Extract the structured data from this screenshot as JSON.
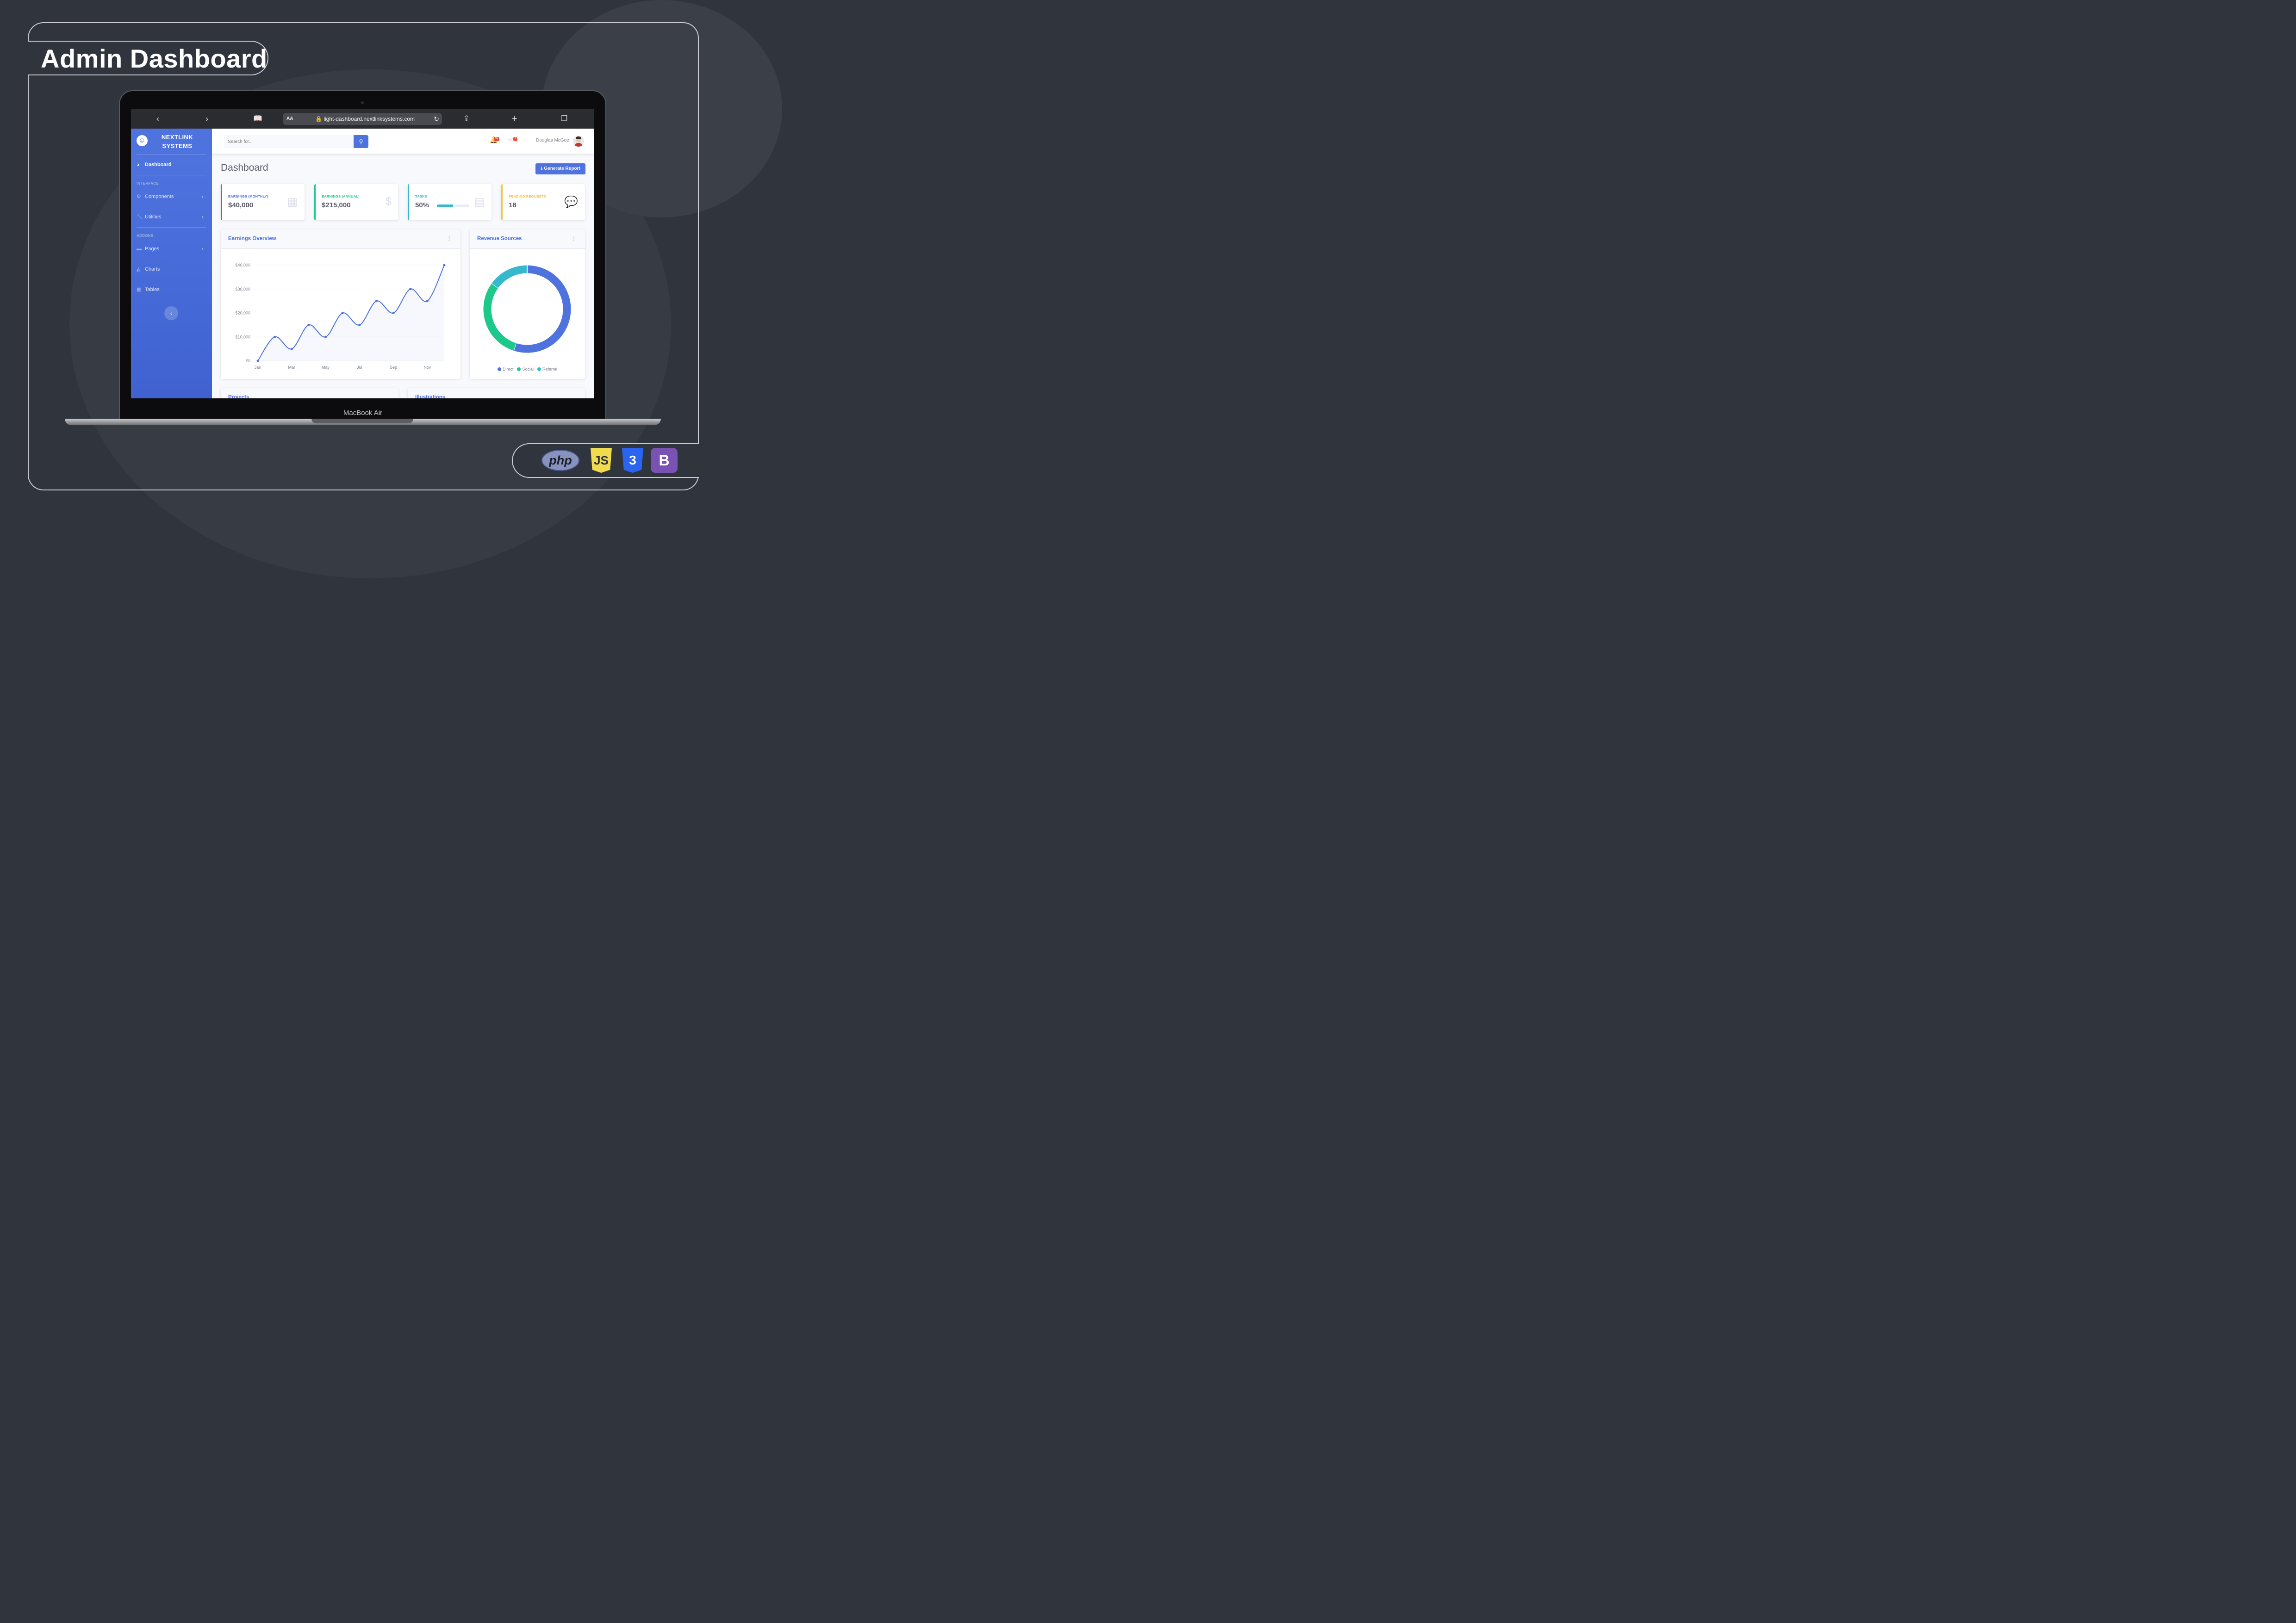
{
  "poster": {
    "title": "Admin Dashboard",
    "device_label": "MacBook Air",
    "tech_logos": [
      {
        "name": "php-logo",
        "text": "php",
        "color": "#8892bf"
      },
      {
        "name": "javascript-logo",
        "text": "JS",
        "color": "#f0db4f"
      },
      {
        "name": "css3-logo",
        "text": "3",
        "color": "#2965f1"
      },
      {
        "name": "bootstrap-logo",
        "text": "B",
        "color": "#7952b3"
      }
    ]
  },
  "browser": {
    "text_size_label": "AA",
    "url": "light-dashboard.nextlinksystems.com"
  },
  "sidebar": {
    "brand": "NEXTLINK SYSTEMS",
    "headings": [
      "INTERFACE",
      "ADDONS"
    ],
    "items": [
      {
        "label": "Dashboard",
        "icon": "tachometer-icon",
        "active": true
      },
      {
        "label": "Components",
        "icon": "cog-icon",
        "has_children": true
      },
      {
        "label": "Utilities",
        "icon": "wrench-icon",
        "has_children": true
      },
      {
        "label": "Pages",
        "icon": "folder-icon",
        "has_children": true
      },
      {
        "label": "Charts",
        "icon": "area-chart-icon"
      },
      {
        "label": "Tables",
        "icon": "table-icon"
      }
    ],
    "primary_color": "#4e73df"
  },
  "topbar": {
    "search_placeholder": "Search for...",
    "alerts_badge": "3+",
    "messages_badge": "7",
    "user_name": "Douglas McGee"
  },
  "page": {
    "heading": "Dashboard",
    "report_button": "Generate Report"
  },
  "stats": [
    {
      "label": "Earnings (Monthly)",
      "value": "$40,000",
      "color": "#4e73df",
      "icon": "calendar-icon"
    },
    {
      "label": "Earnings (Annual)",
      "value": "$215,000",
      "color": "#1cc88a",
      "icon": "dollar-icon"
    },
    {
      "label": "Tasks",
      "value": "50%",
      "progress": 0.5,
      "color": "#36b9cc",
      "icon": "clipboard-list-icon"
    },
    {
      "label": "Pending Requests",
      "value": "18",
      "color": "#f6c23e",
      "icon": "comments-icon"
    }
  ],
  "panels": {
    "earnings_title": "Earnings Overview",
    "revenue_title": "Revenue Sources",
    "projects_title": "Projects",
    "illustrations_title": "Illustrations"
  },
  "chart_data": [
    {
      "type": "area",
      "title": "Earnings Overview",
      "x": [
        "Jan",
        "Feb",
        "Mar",
        "Apr",
        "May",
        "Jun",
        "Jul",
        "Aug",
        "Sep",
        "Oct",
        "Nov",
        "Dec"
      ],
      "x_tick_labels": [
        "Jan",
        "Mar",
        "May",
        "Jul",
        "Sep",
        "Nov"
      ],
      "series": [
        {
          "values": [
            0,
            10000,
            5000,
            15000,
            10000,
            20000,
            15000,
            25000,
            20000,
            30000,
            25000,
            40000
          ]
        }
      ],
      "y_tick_labels": [
        "$0",
        "$10,000",
        "$20,000",
        "$30,000",
        "$40,000"
      ],
      "ylim": [
        0,
        40000
      ],
      "grid": true,
      "line_color": "#4e73df"
    },
    {
      "type": "pie",
      "title": "Revenue Sources",
      "categories": [
        "Direct",
        "Social",
        "Referral"
      ],
      "values": [
        55,
        30,
        15
      ],
      "colors": [
        "#4e73df",
        "#1cc88a",
        "#36b9cc"
      ],
      "legend": "bottom"
    }
  ]
}
